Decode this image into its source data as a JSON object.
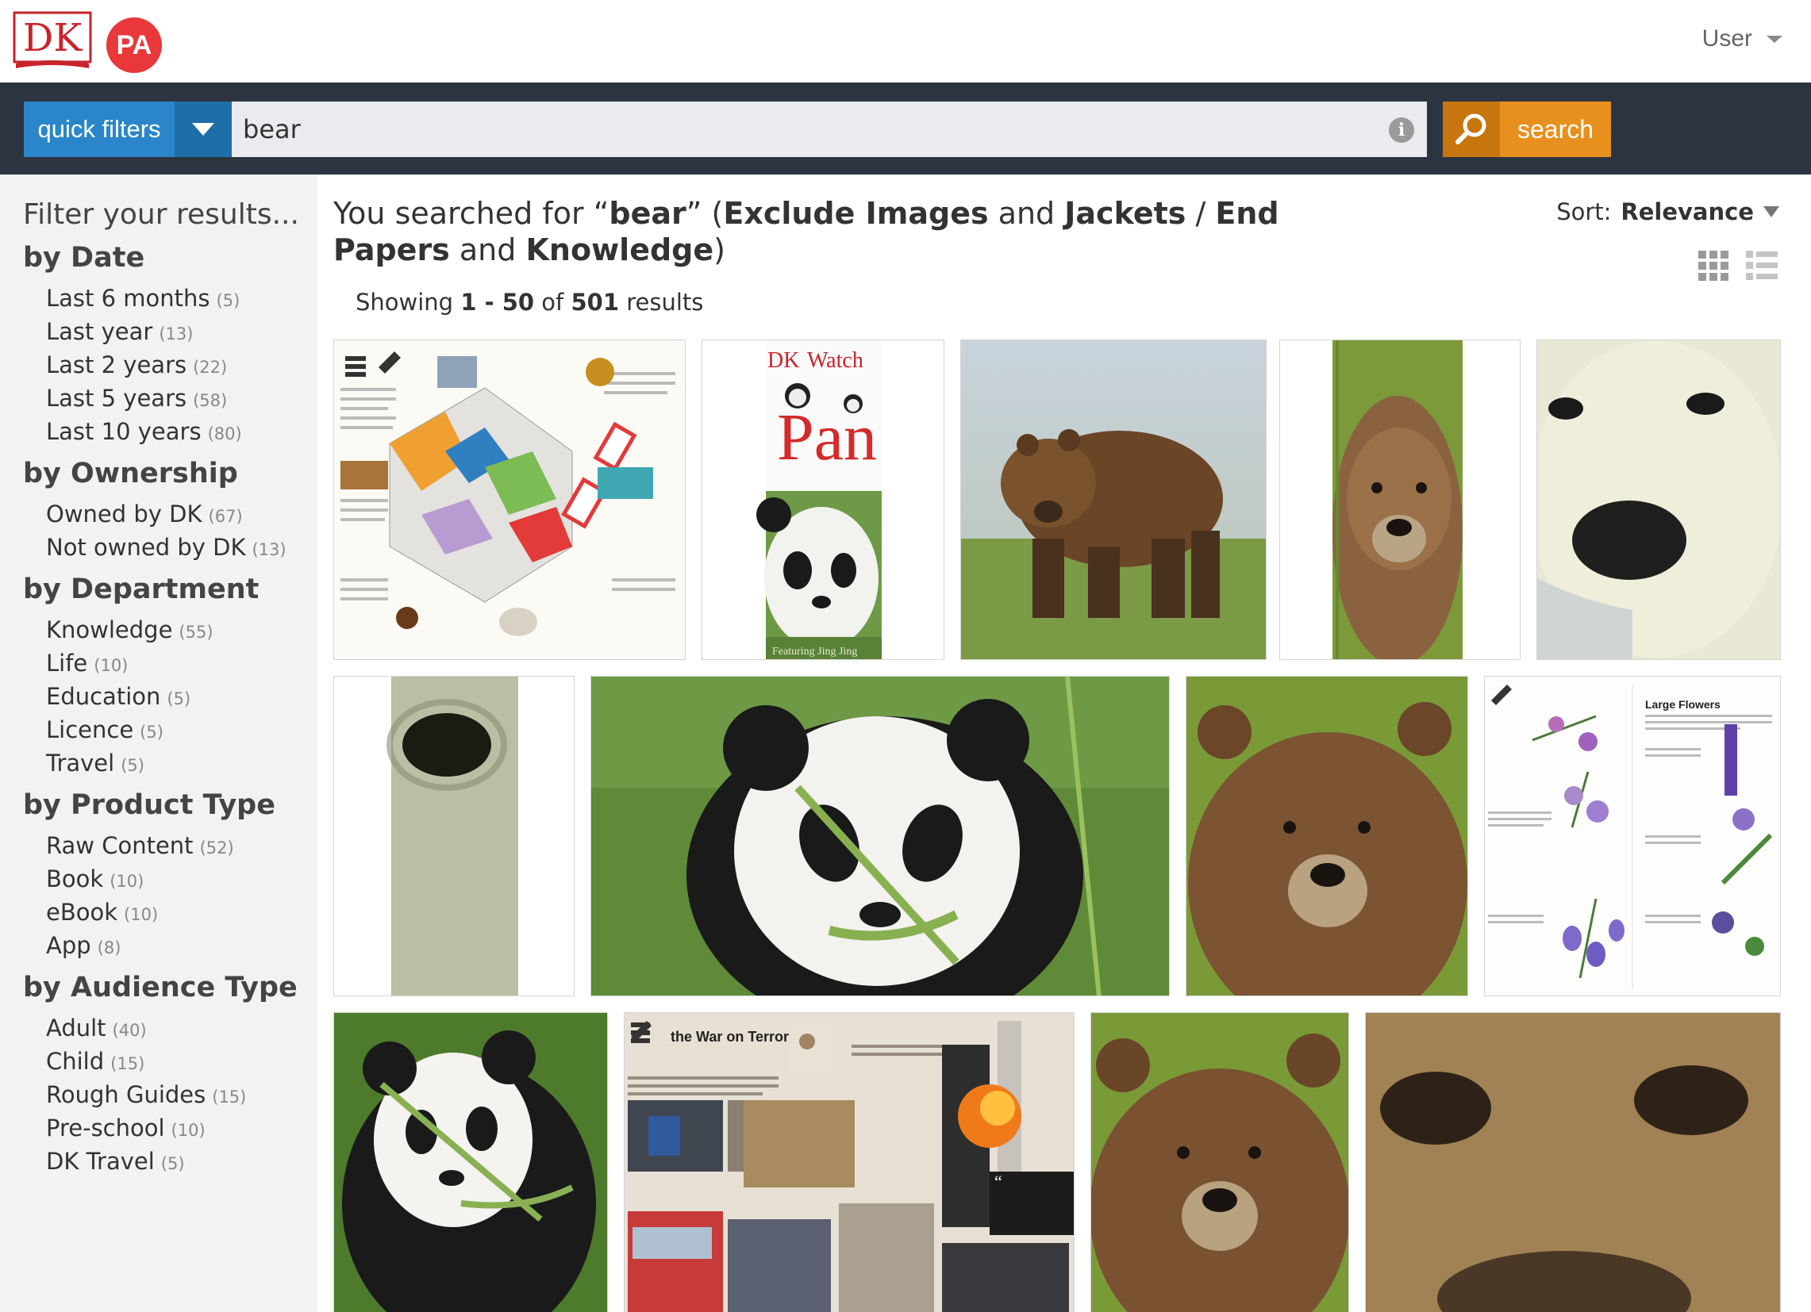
{
  "header": {
    "logo_text": "DK",
    "badge_text": "PA",
    "user_label": "User"
  },
  "search": {
    "quick_filters_label": "quick filters",
    "query": "bear",
    "search_label": "search"
  },
  "sidebar": {
    "title": "Filter your results...",
    "groups": [
      {
        "title": "by Date",
        "items": [
          {
            "label": "Last 6 months",
            "count": "(5)"
          },
          {
            "label": "Last year",
            "count": "(13)"
          },
          {
            "label": "Last 2 years",
            "count": "(22)"
          },
          {
            "label": "Last 5 years",
            "count": "(58)"
          },
          {
            "label": "Last 10 years",
            "count": "(80)"
          }
        ]
      },
      {
        "title": "by Ownership",
        "items": [
          {
            "label": "Owned by DK",
            "count": "(67)"
          },
          {
            "label": "Not owned by DK",
            "count": "(13)"
          }
        ]
      },
      {
        "title": "by Department",
        "items": [
          {
            "label": "Knowledge",
            "count": "(55)"
          },
          {
            "label": "Life",
            "count": "(10)"
          },
          {
            "label": "Education",
            "count": "(5)"
          },
          {
            "label": "Licence",
            "count": "(5)"
          },
          {
            "label": "Travel",
            "count": "(5)"
          }
        ]
      },
      {
        "title": "by Product Type",
        "items": [
          {
            "label": "Raw Content",
            "count": "(52)"
          },
          {
            "label": "Book",
            "count": "(10)"
          },
          {
            "label": "eBook",
            "count": "(10)"
          },
          {
            "label": "App",
            "count": "(8)"
          }
        ]
      },
      {
        "title": "by Audience Type",
        "items": [
          {
            "label": "Adult",
            "count": "(40)"
          },
          {
            "label": "Child",
            "count": "(15)"
          },
          {
            "label": "Rough Guides",
            "count": "(15)"
          },
          {
            "label": "Pre-school",
            "count": "(10)"
          },
          {
            "label": "DK Travel",
            "count": "(5)"
          }
        ]
      }
    ]
  },
  "results": {
    "heading_prefix": "You searched for “",
    "query": "bear",
    "heading_mid1": "” (",
    "filter1": "Exclude Images",
    "and1": " and ",
    "filter2": "Jackets",
    "slash": " / ",
    "filter3": "End Papers",
    "and2": " and ",
    "filter4": "Knowledge",
    "heading_end": ")",
    "showing_prefix": "Showing ",
    "range": "1 - 50",
    "of_text": " of ",
    "total": "501",
    "results_word": " results",
    "sort_label": "Sort:",
    "sort_value": "Relevance"
  },
  "thumbnails": {
    "watch_text": "Watch",
    "panda_cover_text": "Pan",
    "cover_footer": "Featuring Jing Jing",
    "page_heading": "Large Flowers",
    "spread_title": "the War on Terror"
  },
  "colors": {
    "accent_blue": "#2a86c8",
    "search_orange": "#e8901e",
    "navbar": "#2c3442",
    "badge_red": "#e8383a"
  }
}
